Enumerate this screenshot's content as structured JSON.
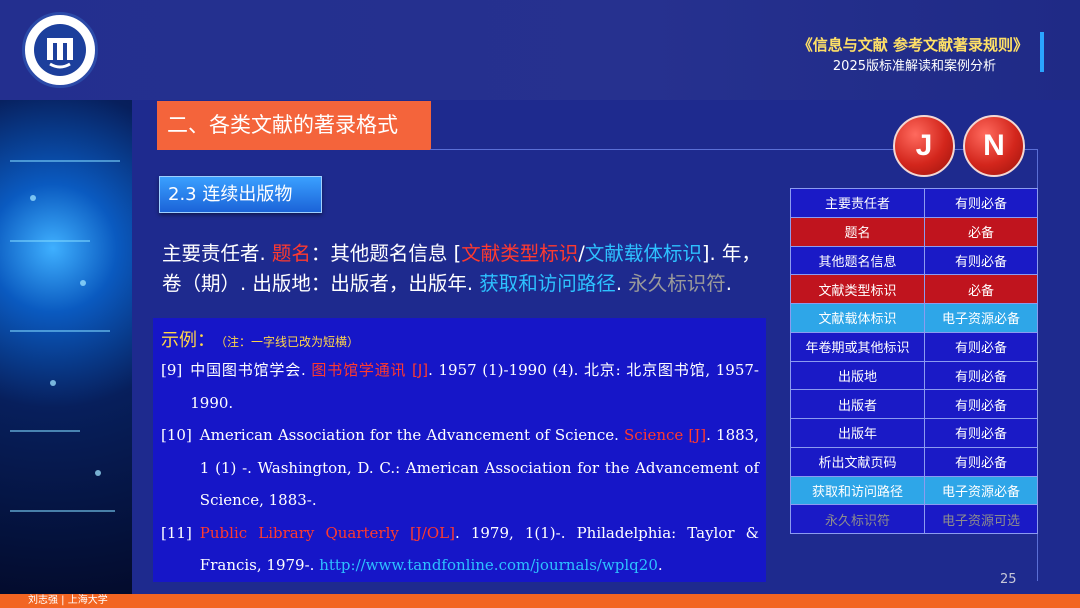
{
  "header": {
    "title": "《信息与文献  参考文献著录规则》",
    "subtitle": "2025版标准解读和案例分析",
    "accent_color": "#ffe066"
  },
  "logo": {
    "icon": "university-seal"
  },
  "section_title": "二、各类文献的著录格式",
  "badges": [
    "J",
    "N"
  ],
  "subsection": "2.3 连续出版物",
  "format": {
    "part1": "主要责任者. ",
    "part2": "题名",
    "part3": "：其他题名信息 [",
    "part4": "文献类型标识",
    "part5": "/",
    "part6": "文献载体标识",
    "part7": "]. 年，卷（期）. 出版地：出版者，出版年. ",
    "part8": "获取和访问路径",
    "part9": ". ",
    "part10": "永久标识符",
    "part11": "."
  },
  "example": {
    "heading": "示例：",
    "note": "（注：一字线已改为短横）",
    "refs": [
      {
        "num": "[9]",
        "a": "中国图书馆学会. ",
        "red": "图书馆学通讯 [J]",
        "b": ". 1957 (1)-1990 (4). 北京: 北京图书馆, 1957-1990.",
        "link": "",
        "c": ""
      },
      {
        "num": "[10]",
        "a": "American Association for the Advancement of Science. ",
        "red": "Science [J]",
        "b": ". 1883, 1 (1) -. Washington, D. C.: American Association for the Advancement of Science, 1883-.",
        "link": "",
        "c": ""
      },
      {
        "num": "[11]",
        "a": "",
        "red": "Public Library Quarterly [J/OL]",
        "b": ". 1979, 1(1)-. Philadelphia: Taylor & Francis, 1979-.  ",
        "link": "http://www.tandfonline.com/journals/wplq20",
        "c": "."
      }
    ]
  },
  "table": [
    {
      "field": "主要责任者",
      "req": "有则必备",
      "style": "blue"
    },
    {
      "field": "题名",
      "req": "必备",
      "style": "red"
    },
    {
      "field": "其他题名信息",
      "req": "有则必备",
      "style": "blue"
    },
    {
      "field": "文献类型标识",
      "req": "必备",
      "style": "red"
    },
    {
      "field": "文献载体标识",
      "req": "电子资源必备",
      "style": "cyan"
    },
    {
      "field": "年卷期或其他标识",
      "req": "有则必备",
      "style": "blue"
    },
    {
      "field": "出版地",
      "req": "有则必备",
      "style": "blue"
    },
    {
      "field": "出版者",
      "req": "有则必备",
      "style": "blue"
    },
    {
      "field": "出版年",
      "req": "有则必备",
      "style": "blue"
    },
    {
      "field": "析出文献页码",
      "req": "有则必备",
      "style": "blue"
    },
    {
      "field": "获取和访问路径",
      "req": "电子资源必备",
      "style": "cyan"
    },
    {
      "field": "永久标识符",
      "req": "电子资源可选",
      "style": "gray"
    }
  ],
  "page_number": "25",
  "footer": "刘志强 | 上海大学"
}
